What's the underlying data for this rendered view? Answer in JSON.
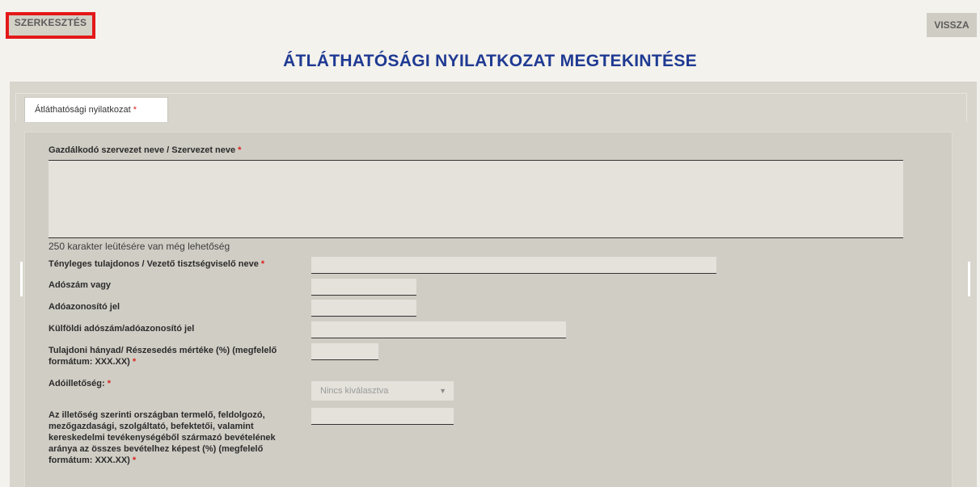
{
  "toolbar": {
    "edit_label": "SZERKESZTÉS",
    "back_label": "VISSZA"
  },
  "page": {
    "title": "ÁTLÁTHATÓSÁGI NYILATKOZAT MEGTEKINTÉSE"
  },
  "tabs": [
    {
      "label": "Átláthatósági nyilatkozat",
      "required": "*"
    }
  ],
  "form": {
    "org_name": {
      "label": "Gazdálkodó szervezet neve / Szervezet neve",
      "required": "*",
      "value": ""
    },
    "char_hint": "250 karakter leütésére van még lehetőség",
    "owner_name": {
      "label": "Tényleges tulajdonos / Vezető tisztségviselő neve",
      "required": "*",
      "value": ""
    },
    "tax_number": {
      "label": "Adószám vagy",
      "value": ""
    },
    "tax_id": {
      "label": "Adóazonosító jel",
      "value": ""
    },
    "foreign_tax": {
      "label": "Külföldi adószám/adóazonosító jel",
      "value": ""
    },
    "ownership_share": {
      "label": "Tulajdoni hányad/ Részesedés mértéke (%) (megfelelő formátum: XXX.XX)",
      "required": "*",
      "value": ""
    },
    "tax_residence": {
      "label": "Adóilletőség:",
      "required": "*",
      "selected": "Nincs kiválasztva"
    },
    "revenue_ratio": {
      "label": "Az illetőség szerinti országban termelő, feldolgozó, mezőgazdasági, szolgáltató, befektetői, valamint kereskedelmi tevékenységéből származó bevételének aránya az összes bevételhez képest (%) (megfelelő formátum: XXX.XX)",
      "required": "*",
      "value": ""
    }
  },
  "icons": {
    "select_caret": "chevron-down-icon"
  },
  "colors": {
    "title": "#1f3a93",
    "required": "#d9231d",
    "highlight_border": "#e31818"
  }
}
